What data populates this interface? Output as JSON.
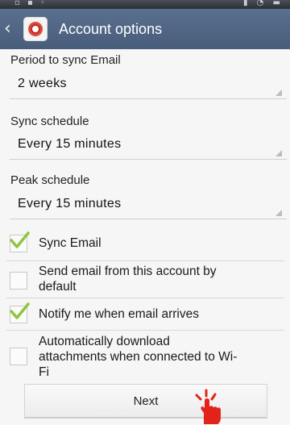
{
  "status_bar": {
    "icons": [
      "image-icon",
      "signal-icon",
      "wifi-icon",
      "battery-icon"
    ]
  },
  "action_bar": {
    "title": "Account options",
    "back_icon": "chevron-left-icon",
    "app_icon": "email-app-icon"
  },
  "fields": [
    {
      "label": "Period to sync Email",
      "value": "2 weeks"
    },
    {
      "label": "Sync schedule",
      "value": "Every 15 minutes"
    },
    {
      "label": "Peak schedule",
      "value": "Every 15 minutes"
    }
  ],
  "options": [
    {
      "label": "Sync Email",
      "checked": true
    },
    {
      "label_line1": "Send email from this account by",
      "label_line2": "default",
      "checked": false
    },
    {
      "label": "Notify me when email arrives",
      "checked": true
    },
    {
      "label_line1": "Automatically download",
      "label_line2": "attachments when connected to Wi-",
      "label_line3": "Fi",
      "checked": false
    }
  ],
  "next_button": {
    "label": "Next"
  },
  "colors": {
    "action_bar": "#4f6583",
    "check": "#8ec63f",
    "tap_hand": "#e2231a"
  }
}
